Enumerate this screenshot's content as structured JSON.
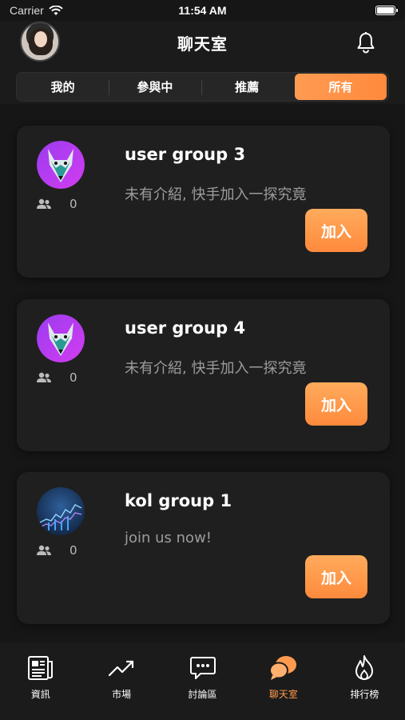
{
  "status_bar": {
    "carrier": "Carrier",
    "time": "11:54 AM"
  },
  "header": {
    "title": "聊天室"
  },
  "tabs": [
    {
      "label": "我的",
      "active": false
    },
    {
      "label": "參與中",
      "active": false
    },
    {
      "label": "推薦",
      "active": false
    },
    {
      "label": "所有",
      "active": true
    }
  ],
  "groups": [
    {
      "name": "user group 3",
      "description": "未有介紹, 快手加入一探究竟",
      "members": "0",
      "join_label": "加入",
      "avatar_icon": "wolf-avatar"
    },
    {
      "name": "user group 4",
      "description": "未有介紹, 快手加入一探究竟",
      "members": "0",
      "join_label": "加入",
      "avatar_icon": "wolf-avatar"
    },
    {
      "name": "kol group 1",
      "description": "join us now!",
      "members": "0",
      "join_label": "加入",
      "avatar_icon": "chart-avatar"
    }
  ],
  "bottom_nav": [
    {
      "label": "資訊",
      "icon": "newspaper-icon",
      "active": false
    },
    {
      "label": "市場",
      "icon": "trend-icon",
      "active": false
    },
    {
      "label": "討論區",
      "icon": "chat-bubble-icon",
      "active": false
    },
    {
      "label": "聊天室",
      "icon": "chat-room-icon",
      "active": true
    },
    {
      "label": "排行榜",
      "icon": "flame-icon",
      "active": false
    }
  ],
  "colors": {
    "accent": "#ff9a4e",
    "background": "#161616",
    "card": "#1f1f1f"
  }
}
